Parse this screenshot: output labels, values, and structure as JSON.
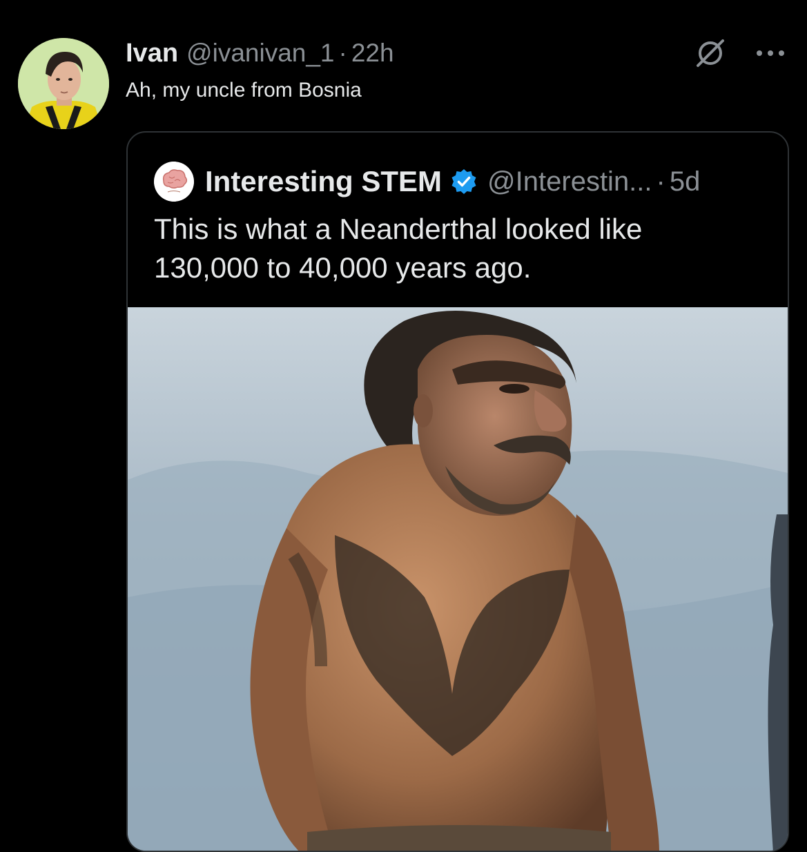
{
  "tweet": {
    "author_name": "Ivan",
    "author_handle": "@ivanivan_1",
    "separator": "·",
    "time": "22h",
    "text": "Ah, my uncle from Bosnia"
  },
  "icons": {
    "avatar": "avatar-photo",
    "grok": "grok-icon",
    "more": "more-options-icon",
    "verified": "verified-badge-icon"
  },
  "quoted_tweet": {
    "author_name": "Interesting STEM",
    "author_handle": "@Interestin...",
    "separator": "·",
    "time": "5d",
    "text_line_1": "This is what a Neanderthal looked like",
    "text_line_2": "130,000 to 40,000 years ago.",
    "media_description_icon": "image"
  },
  "colors": {
    "background": "#000000",
    "text_primary": "#e7e9ea",
    "text_secondary": "#8b9095",
    "border": "#2f3336",
    "verified": "#1d9bf0"
  }
}
